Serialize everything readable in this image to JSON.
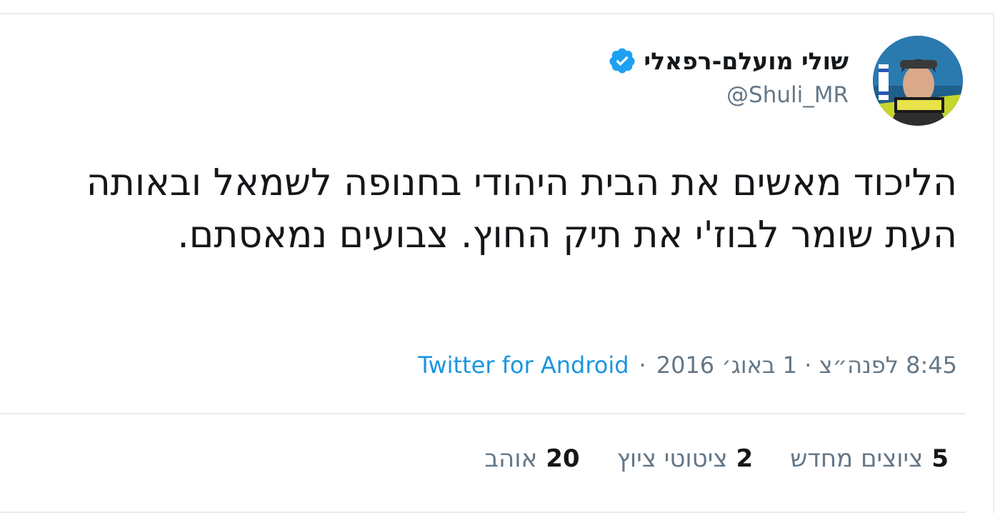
{
  "author": {
    "display_name": "שולי מועלם-רפאלי",
    "handle": "@Shuli_MR",
    "avatar_icon": "avatar-photo",
    "verified_icon": "verified-badge-icon"
  },
  "tweet": {
    "text": "הליכוד מאשים את הבית היהודי בחנופה לשמאל ובאותה העת שומר לבוז'י את תיק החוץ. צבועים נמאסתם.",
    "timestamp": "8:45 לפנה״צ · 1 באוג׳ 2016",
    "separator": "·",
    "source": "Twitter for Android"
  },
  "stats": {
    "retweets_count": "5",
    "retweets_label": "ציוצים מחדש",
    "quotes_count": "2",
    "quotes_label": "ציטוטי ציוץ",
    "likes_count": "20",
    "likes_label": "אוהב"
  },
  "colors": {
    "text": "#14171a",
    "secondary_text": "#657786",
    "link": "#1b95e0",
    "verified": "#1da1f2",
    "border": "#e6ecf0"
  }
}
